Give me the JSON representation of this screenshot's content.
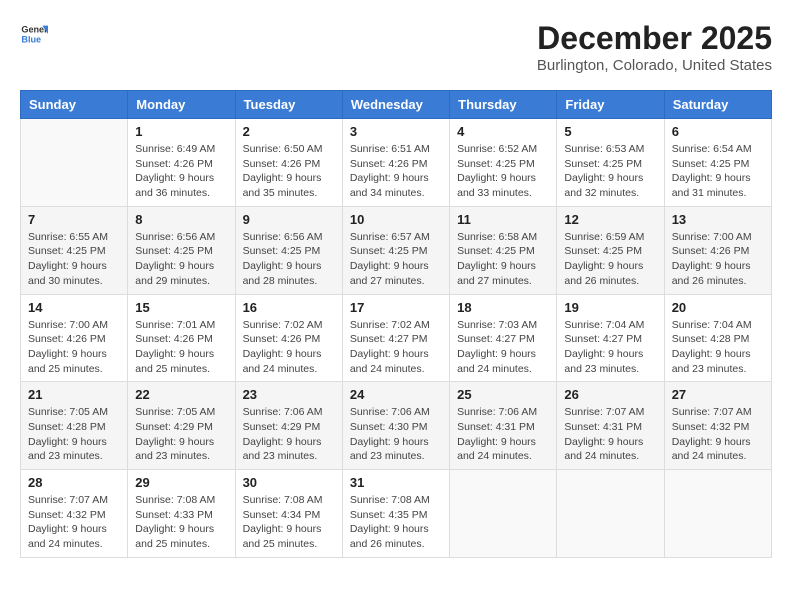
{
  "header": {
    "logo": {
      "general": "General",
      "blue": "Blue"
    },
    "title": "December 2025",
    "subtitle": "Burlington, Colorado, United States"
  },
  "weekdays": [
    "Sunday",
    "Monday",
    "Tuesday",
    "Wednesday",
    "Thursday",
    "Friday",
    "Saturday"
  ],
  "weeks": [
    [
      {
        "day": "",
        "sunrise": "",
        "sunset": "",
        "daylight": "",
        "empty": true
      },
      {
        "day": "1",
        "sunrise": "Sunrise: 6:49 AM",
        "sunset": "Sunset: 4:26 PM",
        "daylight": "Daylight: 9 hours and 36 minutes."
      },
      {
        "day": "2",
        "sunrise": "Sunrise: 6:50 AM",
        "sunset": "Sunset: 4:26 PM",
        "daylight": "Daylight: 9 hours and 35 minutes."
      },
      {
        "day": "3",
        "sunrise": "Sunrise: 6:51 AM",
        "sunset": "Sunset: 4:26 PM",
        "daylight": "Daylight: 9 hours and 34 minutes."
      },
      {
        "day": "4",
        "sunrise": "Sunrise: 6:52 AM",
        "sunset": "Sunset: 4:25 PM",
        "daylight": "Daylight: 9 hours and 33 minutes."
      },
      {
        "day": "5",
        "sunrise": "Sunrise: 6:53 AM",
        "sunset": "Sunset: 4:25 PM",
        "daylight": "Daylight: 9 hours and 32 minutes."
      },
      {
        "day": "6",
        "sunrise": "Sunrise: 6:54 AM",
        "sunset": "Sunset: 4:25 PM",
        "daylight": "Daylight: 9 hours and 31 minutes."
      }
    ],
    [
      {
        "day": "7",
        "sunrise": "Sunrise: 6:55 AM",
        "sunset": "Sunset: 4:25 PM",
        "daylight": "Daylight: 9 hours and 30 minutes."
      },
      {
        "day": "8",
        "sunrise": "Sunrise: 6:56 AM",
        "sunset": "Sunset: 4:25 PM",
        "daylight": "Daylight: 9 hours and 29 minutes."
      },
      {
        "day": "9",
        "sunrise": "Sunrise: 6:56 AM",
        "sunset": "Sunset: 4:25 PM",
        "daylight": "Daylight: 9 hours and 28 minutes."
      },
      {
        "day": "10",
        "sunrise": "Sunrise: 6:57 AM",
        "sunset": "Sunset: 4:25 PM",
        "daylight": "Daylight: 9 hours and 27 minutes."
      },
      {
        "day": "11",
        "sunrise": "Sunrise: 6:58 AM",
        "sunset": "Sunset: 4:25 PM",
        "daylight": "Daylight: 9 hours and 27 minutes."
      },
      {
        "day": "12",
        "sunrise": "Sunrise: 6:59 AM",
        "sunset": "Sunset: 4:25 PM",
        "daylight": "Daylight: 9 hours and 26 minutes."
      },
      {
        "day": "13",
        "sunrise": "Sunrise: 7:00 AM",
        "sunset": "Sunset: 4:26 PM",
        "daylight": "Daylight: 9 hours and 26 minutes."
      }
    ],
    [
      {
        "day": "14",
        "sunrise": "Sunrise: 7:00 AM",
        "sunset": "Sunset: 4:26 PM",
        "daylight": "Daylight: 9 hours and 25 minutes."
      },
      {
        "day": "15",
        "sunrise": "Sunrise: 7:01 AM",
        "sunset": "Sunset: 4:26 PM",
        "daylight": "Daylight: 9 hours and 25 minutes."
      },
      {
        "day": "16",
        "sunrise": "Sunrise: 7:02 AM",
        "sunset": "Sunset: 4:26 PM",
        "daylight": "Daylight: 9 hours and 24 minutes."
      },
      {
        "day": "17",
        "sunrise": "Sunrise: 7:02 AM",
        "sunset": "Sunset: 4:27 PM",
        "daylight": "Daylight: 9 hours and 24 minutes."
      },
      {
        "day": "18",
        "sunrise": "Sunrise: 7:03 AM",
        "sunset": "Sunset: 4:27 PM",
        "daylight": "Daylight: 9 hours and 24 minutes."
      },
      {
        "day": "19",
        "sunrise": "Sunrise: 7:04 AM",
        "sunset": "Sunset: 4:27 PM",
        "daylight": "Daylight: 9 hours and 23 minutes."
      },
      {
        "day": "20",
        "sunrise": "Sunrise: 7:04 AM",
        "sunset": "Sunset: 4:28 PM",
        "daylight": "Daylight: 9 hours and 23 minutes."
      }
    ],
    [
      {
        "day": "21",
        "sunrise": "Sunrise: 7:05 AM",
        "sunset": "Sunset: 4:28 PM",
        "daylight": "Daylight: 9 hours and 23 minutes."
      },
      {
        "day": "22",
        "sunrise": "Sunrise: 7:05 AM",
        "sunset": "Sunset: 4:29 PM",
        "daylight": "Daylight: 9 hours and 23 minutes."
      },
      {
        "day": "23",
        "sunrise": "Sunrise: 7:06 AM",
        "sunset": "Sunset: 4:29 PM",
        "daylight": "Daylight: 9 hours and 23 minutes."
      },
      {
        "day": "24",
        "sunrise": "Sunrise: 7:06 AM",
        "sunset": "Sunset: 4:30 PM",
        "daylight": "Daylight: 9 hours and 23 minutes."
      },
      {
        "day": "25",
        "sunrise": "Sunrise: 7:06 AM",
        "sunset": "Sunset: 4:31 PM",
        "daylight": "Daylight: 9 hours and 24 minutes."
      },
      {
        "day": "26",
        "sunrise": "Sunrise: 7:07 AM",
        "sunset": "Sunset: 4:31 PM",
        "daylight": "Daylight: 9 hours and 24 minutes."
      },
      {
        "day": "27",
        "sunrise": "Sunrise: 7:07 AM",
        "sunset": "Sunset: 4:32 PM",
        "daylight": "Daylight: 9 hours and 24 minutes."
      }
    ],
    [
      {
        "day": "28",
        "sunrise": "Sunrise: 7:07 AM",
        "sunset": "Sunset: 4:32 PM",
        "daylight": "Daylight: 9 hours and 24 minutes."
      },
      {
        "day": "29",
        "sunrise": "Sunrise: 7:08 AM",
        "sunset": "Sunset: 4:33 PM",
        "daylight": "Daylight: 9 hours and 25 minutes."
      },
      {
        "day": "30",
        "sunrise": "Sunrise: 7:08 AM",
        "sunset": "Sunset: 4:34 PM",
        "daylight": "Daylight: 9 hours and 25 minutes."
      },
      {
        "day": "31",
        "sunrise": "Sunrise: 7:08 AM",
        "sunset": "Sunset: 4:35 PM",
        "daylight": "Daylight: 9 hours and 26 minutes."
      },
      {
        "day": "",
        "sunrise": "",
        "sunset": "",
        "daylight": "",
        "empty": true
      },
      {
        "day": "",
        "sunrise": "",
        "sunset": "",
        "daylight": "",
        "empty": true
      },
      {
        "day": "",
        "sunrise": "",
        "sunset": "",
        "daylight": "",
        "empty": true
      }
    ]
  ]
}
